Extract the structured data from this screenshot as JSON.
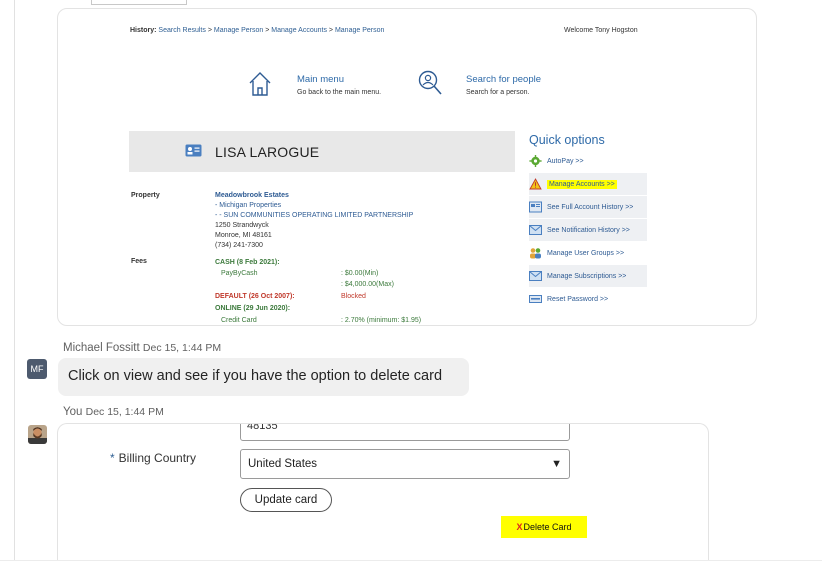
{
  "screenshot1": {
    "history": {
      "label": "History:",
      "crumbs": [
        "Search Results",
        "Manage Person",
        "Manage Accounts",
        "Manage Person"
      ],
      "separator": ">"
    },
    "welcome": "Welcome Tony Hogston",
    "nav": [
      {
        "title": "Main menu",
        "subtitle": "Go back to the main menu.",
        "icon": "home-icon"
      },
      {
        "title": "Search for people",
        "subtitle": "Search for a person.",
        "icon": "search-person-icon"
      }
    ],
    "person_name": "LISA LAROGUE",
    "property": {
      "label": "Property",
      "name": "Meadowbrook Estates",
      "line1": "- Michigan Properties",
      "line2": "- - SUN COMMUNITIES OPERATING LIMITED PARTNERSHIP",
      "address1": "1250 Strandwyck",
      "address2": "Monroe, MI 48161",
      "phone": "(734) 241-7300"
    },
    "fees": {
      "label": "Fees",
      "cash_header": "CASH (8 Feb 2021):",
      "paybycash": "PayByCash",
      "min": ": $0.00(Min)",
      "max": ": $4,000.00(Max)",
      "default_header": "DEFAULT (26 Oct 2007):",
      "blocked": "Blocked",
      "online_header": "ONLINE (29 Jun 2020):",
      "credit_card": "Credit Card",
      "credit_rate": ": 2.70% (minimum: $1.95)"
    },
    "quick_options": {
      "title": "Quick options",
      "items": [
        {
          "label": "AutoPay >>",
          "icon": "autopay-gear-icon"
        },
        {
          "label": "Manage Accounts >>",
          "icon": "warning-icon"
        },
        {
          "label": "See Full Account History >>",
          "icon": "account-history-icon"
        },
        {
          "label": "See Notification History >>",
          "icon": "notification-history-icon"
        },
        {
          "label": "Manage User Groups >>",
          "icon": "user-groups-icon"
        },
        {
          "label": "Manage Subscriptions >>",
          "icon": "subscriptions-icon"
        },
        {
          "label": "Reset Password >>",
          "icon": "reset-password-icon"
        }
      ]
    }
  },
  "chat": {
    "msg1": {
      "sender": "Michael Fossitt",
      "time": "Dec 15, 1:44 PM",
      "initials": "MF",
      "text": "Click on view and see if you have the option to delete card"
    },
    "msg2": {
      "sender": "You",
      "time": "Dec 15, 1:44 PM"
    }
  },
  "screenshot2": {
    "zip_value": "48135",
    "billing_country_label": "Billing Country",
    "required_marker": "*",
    "billing_country_value": "United States",
    "update_button": "Update card",
    "delete_x": "X",
    "delete_label": "Delete Card"
  },
  "colors": {
    "link_blue": "#2e6aa8",
    "highlight": "#ffff00",
    "blocked_red": "#c0392b",
    "fee_green": "#3c7a3c"
  }
}
